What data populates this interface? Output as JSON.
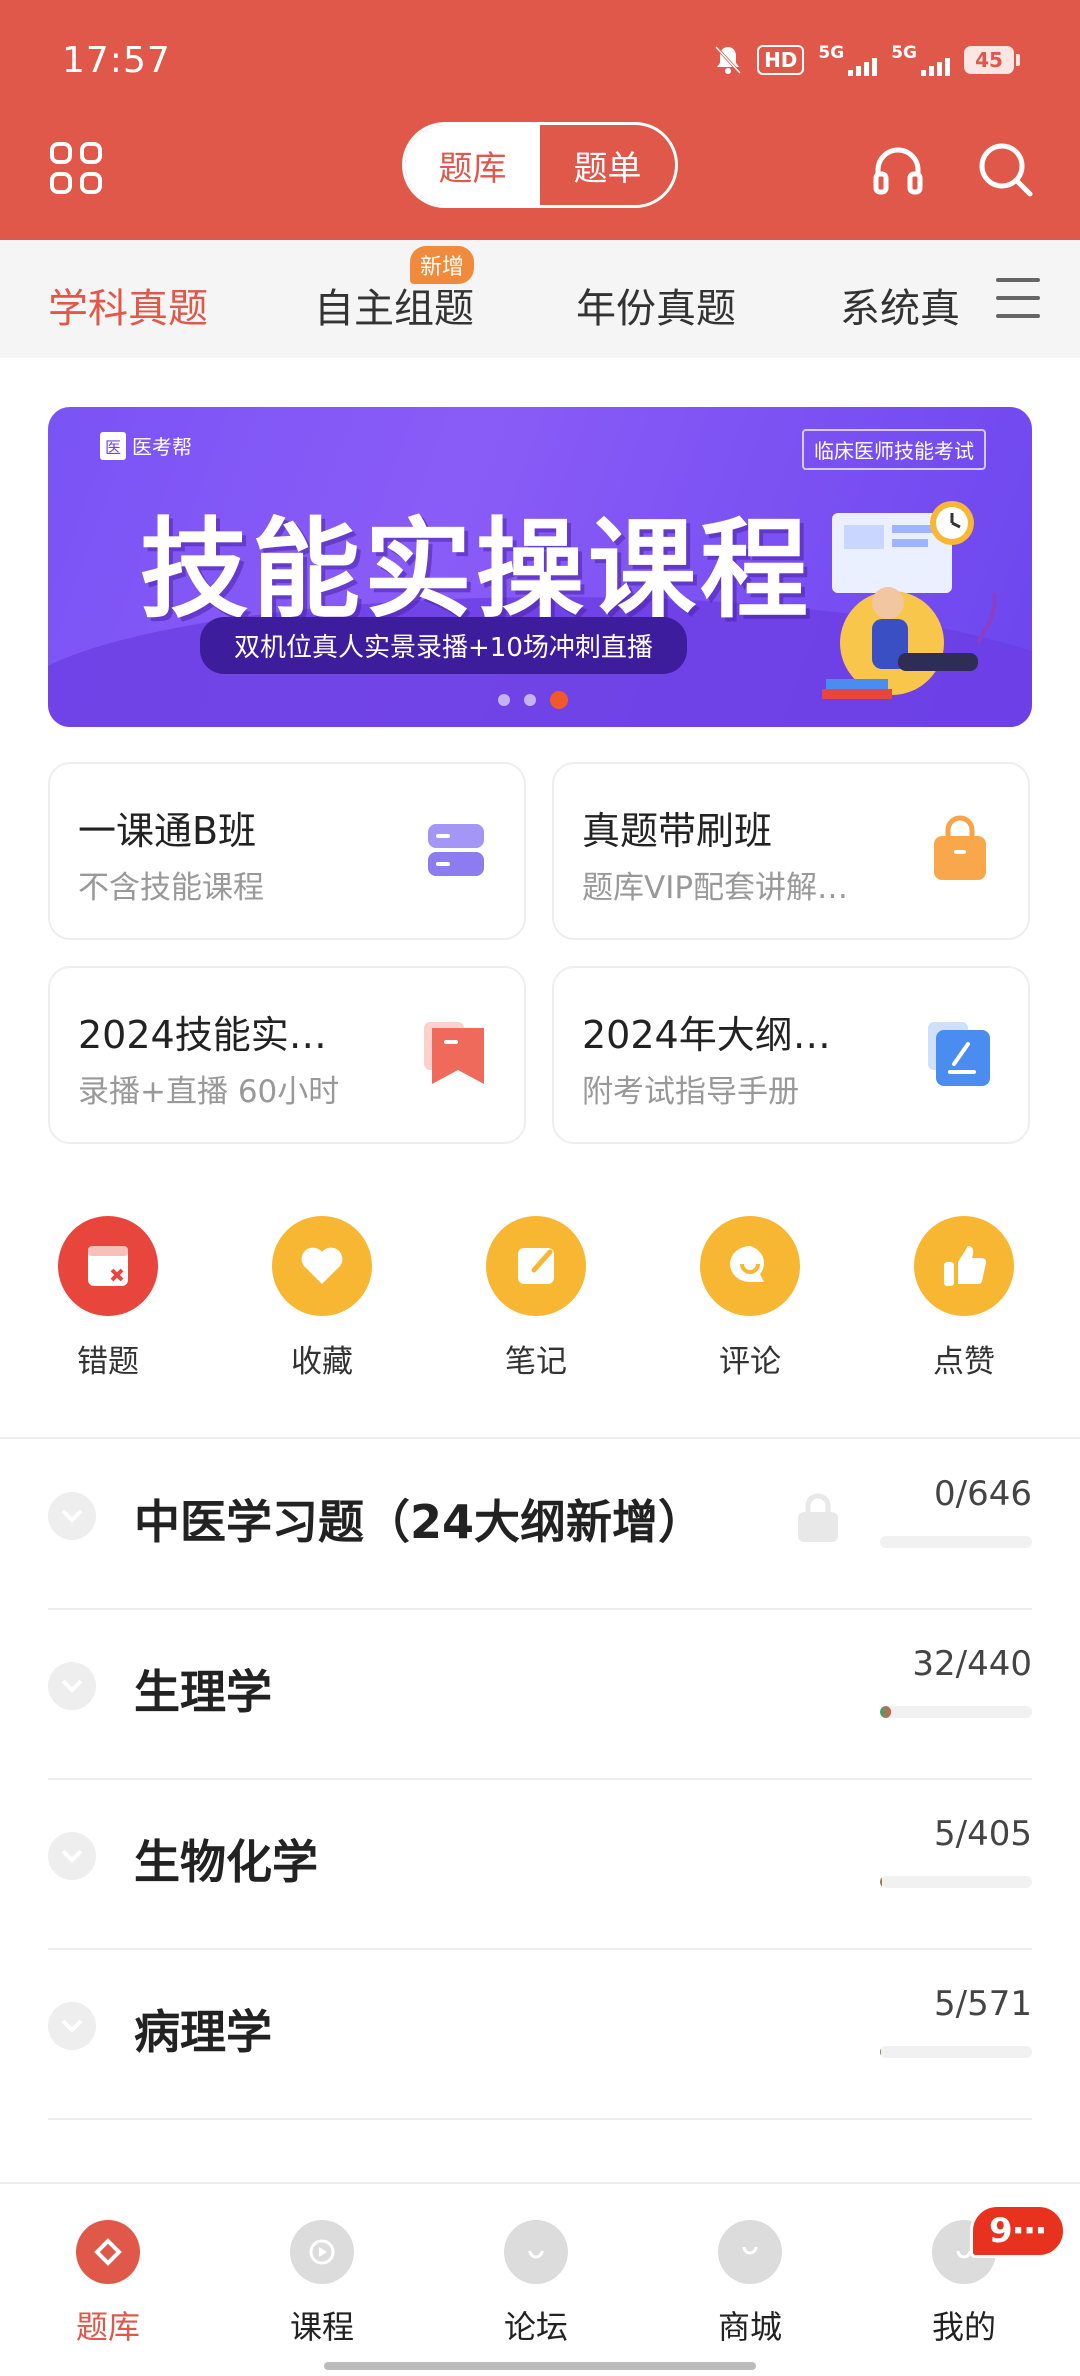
{
  "status_bar": {
    "time": "17:57",
    "hd_label": "HD",
    "net1": "5G",
    "net2": "5G",
    "battery": "45"
  },
  "header": {
    "segment_active": "题库",
    "segment_inactive": "题单",
    "icons": [
      "grid-icon",
      "headset-icon",
      "search-icon"
    ]
  },
  "tabs": {
    "items": [
      "学科真题",
      "自主组题",
      "年份真题",
      "系统真"
    ],
    "new_badge": "新增"
  },
  "banner": {
    "brand": "医考帮",
    "tag": "临床医师技能考试",
    "title": "技能实操课程",
    "subtitle": "双机位真人实景录播+10场冲刺直播",
    "slide_count": 3,
    "active_slide": 3
  },
  "cards": [
    {
      "title": "一课通B班",
      "subtitle": "不含技能课程",
      "icon": "stack-icon",
      "color": "#9a8cf2"
    },
    {
      "title": "真题带刷班",
      "subtitle": "题库VIP配套讲解…",
      "icon": "bag-icon",
      "color": "#f7a34a"
    },
    {
      "title": "2024技能实…",
      "subtitle": "录播+直播  60小时",
      "icon": "bookmark-icon",
      "color": "#f06a5c"
    },
    {
      "title": "2024年大纲…",
      "subtitle": "附考试指导手册",
      "icon": "edit-icon",
      "color": "#4a8cf0"
    }
  ],
  "quick_actions": [
    {
      "label": "错题",
      "icon": "wrong-icon",
      "color": "#e8453c"
    },
    {
      "label": "收藏",
      "icon": "heart-icon",
      "color": "#f7b733"
    },
    {
      "label": "笔记",
      "icon": "note-icon",
      "color": "#f7b733"
    },
    {
      "label": "评论",
      "icon": "comment-icon",
      "color": "#f7b733"
    },
    {
      "label": "点赞",
      "icon": "thumb-icon",
      "color": "#f7b733"
    }
  ],
  "subjects": [
    {
      "name": "中医学习题（24大纲新增）",
      "count": "0/646",
      "progress": 0,
      "locked": true
    },
    {
      "name": "生理学",
      "count": "32/440",
      "progress": 0.073,
      "locked": false
    },
    {
      "name": "生物化学",
      "count": "5/405",
      "progress": 0.012,
      "locked": false
    },
    {
      "name": "病理学",
      "count": "5/571",
      "progress": 0.009,
      "locked": false
    }
  ],
  "bottom_nav": [
    {
      "label": "题库",
      "icon": "question-bank-icon",
      "active": true
    },
    {
      "label": "课程",
      "icon": "play-icon",
      "active": false
    },
    {
      "label": "论坛",
      "icon": "forum-icon",
      "active": false
    },
    {
      "label": "商城",
      "icon": "shop-icon",
      "active": false
    },
    {
      "label": "我的",
      "icon": "profile-icon",
      "active": false
    }
  ],
  "notification_badge": "9⋯",
  "colors": {
    "accent": "#e0584a",
    "banner": "#7a53f5"
  }
}
